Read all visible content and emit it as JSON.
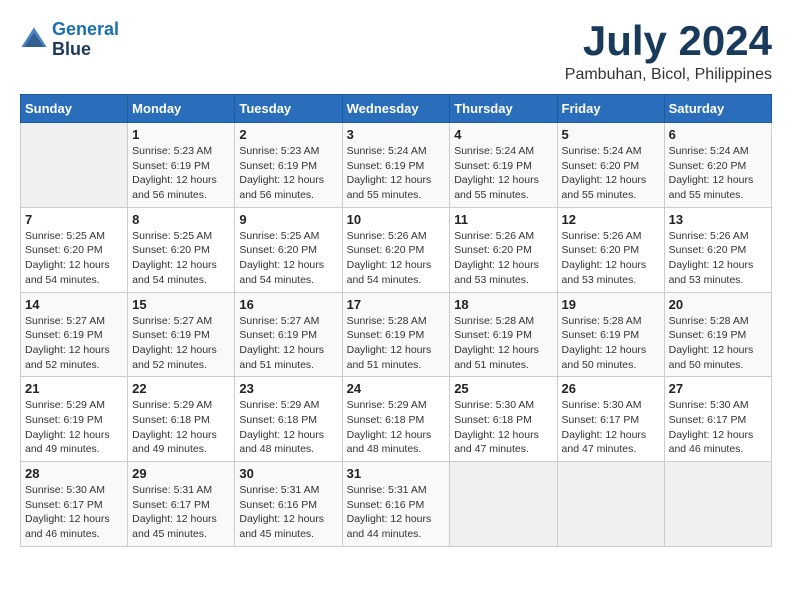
{
  "header": {
    "logo_line1": "General",
    "logo_line2": "Blue",
    "month": "July 2024",
    "location": "Pambuhan, Bicol, Philippines"
  },
  "days_of_week": [
    "Sunday",
    "Monday",
    "Tuesday",
    "Wednesday",
    "Thursday",
    "Friday",
    "Saturday"
  ],
  "weeks": [
    [
      {
        "day": "",
        "info": ""
      },
      {
        "day": "1",
        "info": "Sunrise: 5:23 AM\nSunset: 6:19 PM\nDaylight: 12 hours\nand 56 minutes."
      },
      {
        "day": "2",
        "info": "Sunrise: 5:23 AM\nSunset: 6:19 PM\nDaylight: 12 hours\nand 56 minutes."
      },
      {
        "day": "3",
        "info": "Sunrise: 5:24 AM\nSunset: 6:19 PM\nDaylight: 12 hours\nand 55 minutes."
      },
      {
        "day": "4",
        "info": "Sunrise: 5:24 AM\nSunset: 6:19 PM\nDaylight: 12 hours\nand 55 minutes."
      },
      {
        "day": "5",
        "info": "Sunrise: 5:24 AM\nSunset: 6:20 PM\nDaylight: 12 hours\nand 55 minutes."
      },
      {
        "day": "6",
        "info": "Sunrise: 5:24 AM\nSunset: 6:20 PM\nDaylight: 12 hours\nand 55 minutes."
      }
    ],
    [
      {
        "day": "7",
        "info": "Sunrise: 5:25 AM\nSunset: 6:20 PM\nDaylight: 12 hours\nand 54 minutes."
      },
      {
        "day": "8",
        "info": "Sunrise: 5:25 AM\nSunset: 6:20 PM\nDaylight: 12 hours\nand 54 minutes."
      },
      {
        "day": "9",
        "info": "Sunrise: 5:25 AM\nSunset: 6:20 PM\nDaylight: 12 hours\nand 54 minutes."
      },
      {
        "day": "10",
        "info": "Sunrise: 5:26 AM\nSunset: 6:20 PM\nDaylight: 12 hours\nand 54 minutes."
      },
      {
        "day": "11",
        "info": "Sunrise: 5:26 AM\nSunset: 6:20 PM\nDaylight: 12 hours\nand 53 minutes."
      },
      {
        "day": "12",
        "info": "Sunrise: 5:26 AM\nSunset: 6:20 PM\nDaylight: 12 hours\nand 53 minutes."
      },
      {
        "day": "13",
        "info": "Sunrise: 5:26 AM\nSunset: 6:20 PM\nDaylight: 12 hours\nand 53 minutes."
      }
    ],
    [
      {
        "day": "14",
        "info": "Sunrise: 5:27 AM\nSunset: 6:19 PM\nDaylight: 12 hours\nand 52 minutes."
      },
      {
        "day": "15",
        "info": "Sunrise: 5:27 AM\nSunset: 6:19 PM\nDaylight: 12 hours\nand 52 minutes."
      },
      {
        "day": "16",
        "info": "Sunrise: 5:27 AM\nSunset: 6:19 PM\nDaylight: 12 hours\nand 51 minutes."
      },
      {
        "day": "17",
        "info": "Sunrise: 5:28 AM\nSunset: 6:19 PM\nDaylight: 12 hours\nand 51 minutes."
      },
      {
        "day": "18",
        "info": "Sunrise: 5:28 AM\nSunset: 6:19 PM\nDaylight: 12 hours\nand 51 minutes."
      },
      {
        "day": "19",
        "info": "Sunrise: 5:28 AM\nSunset: 6:19 PM\nDaylight: 12 hours\nand 50 minutes."
      },
      {
        "day": "20",
        "info": "Sunrise: 5:28 AM\nSunset: 6:19 PM\nDaylight: 12 hours\nand 50 minutes."
      }
    ],
    [
      {
        "day": "21",
        "info": "Sunrise: 5:29 AM\nSunset: 6:19 PM\nDaylight: 12 hours\nand 49 minutes."
      },
      {
        "day": "22",
        "info": "Sunrise: 5:29 AM\nSunset: 6:18 PM\nDaylight: 12 hours\nand 49 minutes."
      },
      {
        "day": "23",
        "info": "Sunrise: 5:29 AM\nSunset: 6:18 PM\nDaylight: 12 hours\nand 48 minutes."
      },
      {
        "day": "24",
        "info": "Sunrise: 5:29 AM\nSunset: 6:18 PM\nDaylight: 12 hours\nand 48 minutes."
      },
      {
        "day": "25",
        "info": "Sunrise: 5:30 AM\nSunset: 6:18 PM\nDaylight: 12 hours\nand 47 minutes."
      },
      {
        "day": "26",
        "info": "Sunrise: 5:30 AM\nSunset: 6:17 PM\nDaylight: 12 hours\nand 47 minutes."
      },
      {
        "day": "27",
        "info": "Sunrise: 5:30 AM\nSunset: 6:17 PM\nDaylight: 12 hours\nand 46 minutes."
      }
    ],
    [
      {
        "day": "28",
        "info": "Sunrise: 5:30 AM\nSunset: 6:17 PM\nDaylight: 12 hours\nand 46 minutes."
      },
      {
        "day": "29",
        "info": "Sunrise: 5:31 AM\nSunset: 6:17 PM\nDaylight: 12 hours\nand 45 minutes."
      },
      {
        "day": "30",
        "info": "Sunrise: 5:31 AM\nSunset: 6:16 PM\nDaylight: 12 hours\nand 45 minutes."
      },
      {
        "day": "31",
        "info": "Sunrise: 5:31 AM\nSunset: 6:16 PM\nDaylight: 12 hours\nand 44 minutes."
      },
      {
        "day": "",
        "info": ""
      },
      {
        "day": "",
        "info": ""
      },
      {
        "day": "",
        "info": ""
      }
    ]
  ]
}
